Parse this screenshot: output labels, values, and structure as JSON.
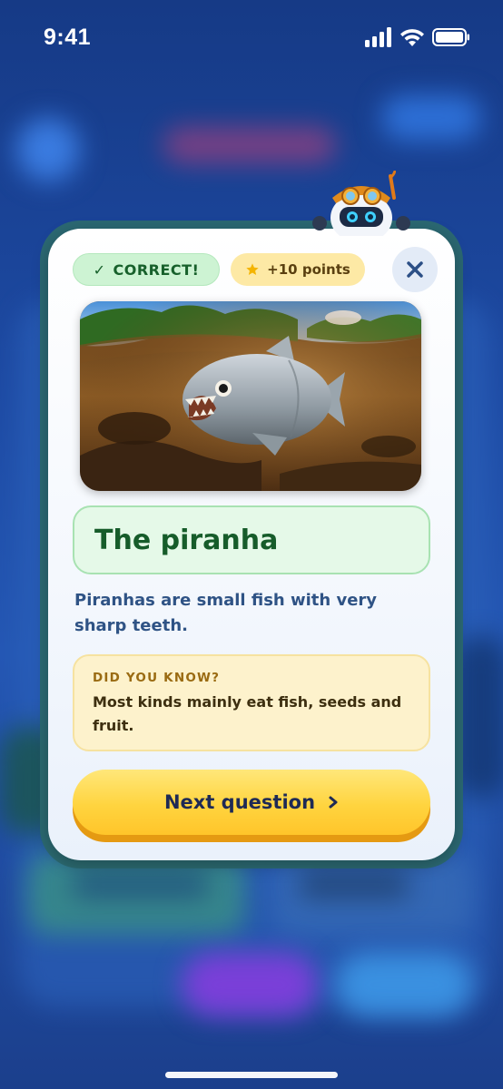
{
  "status_bar": {
    "time": "9:41"
  },
  "badges": {
    "correct_check": "✓",
    "correct_label": "CORRECT!",
    "points_label": "+10 points",
    "points_icon": "star-icon"
  },
  "close_button": {
    "icon": "close-icon"
  },
  "answer": {
    "title": "The piranha",
    "description": "Piranhas are small fish with very sharp teeth."
  },
  "fact": {
    "label": "DID YOU KNOW?",
    "text": "Most kinds mainly eat fish, seeds and fruit."
  },
  "next_button": {
    "label": "Next question",
    "icon": "chevron-right-icon"
  },
  "colors": {
    "correct_green": "#17602b",
    "points_gold": "#fde9a5",
    "button_yellow": "#ffd43f",
    "text_blue": "#2f5385"
  }
}
